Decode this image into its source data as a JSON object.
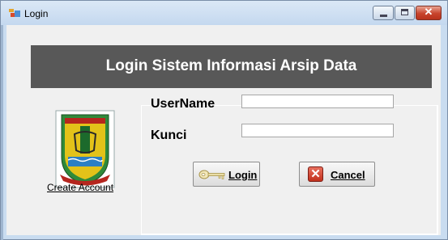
{
  "window": {
    "title": "Login",
    "controls": {
      "minimize": "minimize",
      "maximize": "maximize",
      "close": "✕"
    }
  },
  "banner": {
    "title": "Login Sistem Informasi Arsip Data"
  },
  "form": {
    "username_label": "UserName",
    "username_value": "",
    "password_label": "Kunci",
    "password_value": "",
    "login_button": "Login",
    "cancel_button": "Cancel"
  },
  "links": {
    "create_account": "Create Account"
  },
  "icons": {
    "app": "login-window-icon",
    "logo": "regency-emblem-icon",
    "login": "key-icon",
    "cancel": "red-x-icon"
  },
  "colors": {
    "banner_bg": "#585858",
    "banner_text": "#ffffff",
    "window_frame": "#c9dcf0",
    "client_bg": "#f0f0f0",
    "close_button": "#c7432c"
  }
}
